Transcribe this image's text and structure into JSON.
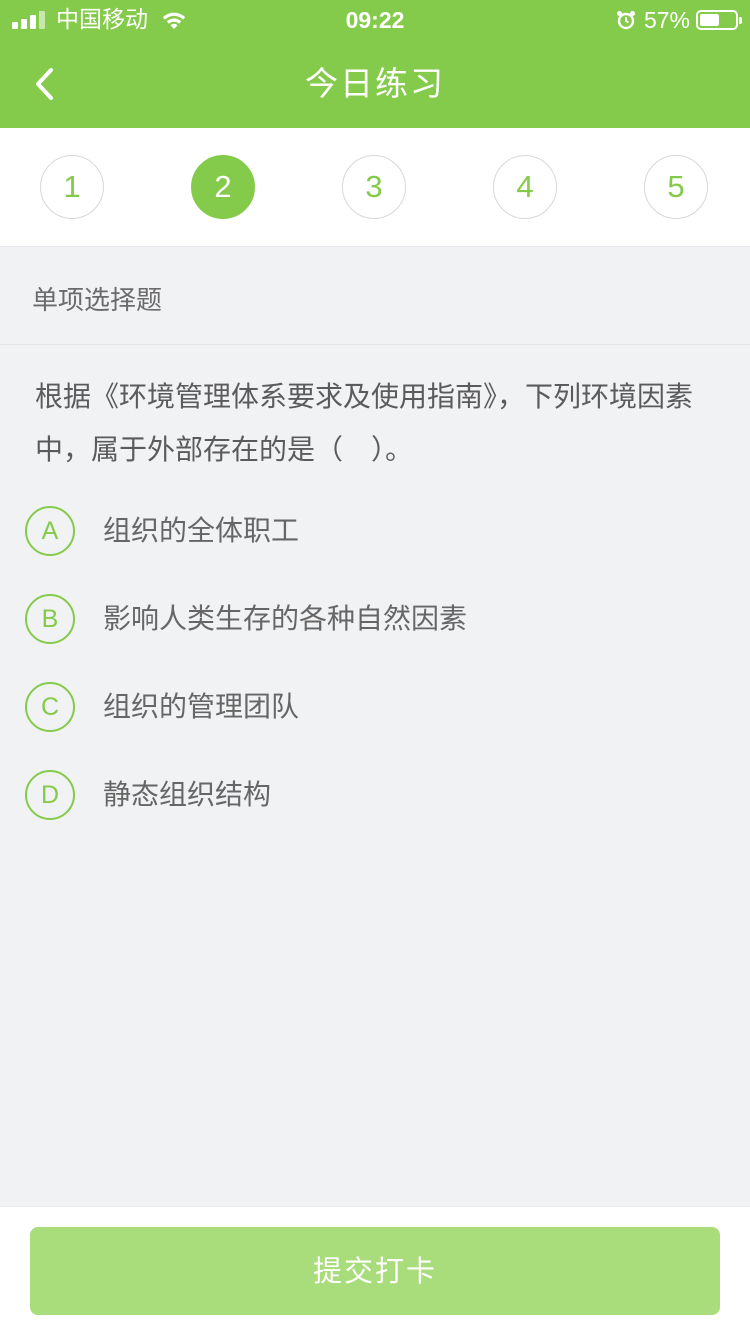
{
  "status_bar": {
    "carrier": "中国移动",
    "time": "09:22",
    "battery_percent": "57%",
    "battery_level": 0.57,
    "icons": [
      "signal-icon",
      "wifi-icon",
      "alarm-icon",
      "battery-icon"
    ]
  },
  "nav": {
    "title": "今日练习",
    "back_icon": "chevron-left-icon"
  },
  "steps": {
    "items": [
      "1",
      "2",
      "3",
      "4",
      "5"
    ],
    "active_index": 1
  },
  "question": {
    "type": "单项选择题",
    "text": "根据《环境管理体系要求及使用指南》，下列环境因素中，属于外部存在的是（　）。",
    "options": [
      {
        "letter": "A",
        "text": "组织的全体职工"
      },
      {
        "letter": "B",
        "text": "影响人类生存的各种自然因素"
      },
      {
        "letter": "C",
        "text": "组织的管理团队"
      },
      {
        "letter": "D",
        "text": "静态组织结构"
      }
    ]
  },
  "footer": {
    "submit_label": "提交打卡"
  },
  "colors": {
    "accent": "#85cb4b",
    "submit_disabled": "#a9dc7a",
    "background": "#f1f2f4"
  }
}
